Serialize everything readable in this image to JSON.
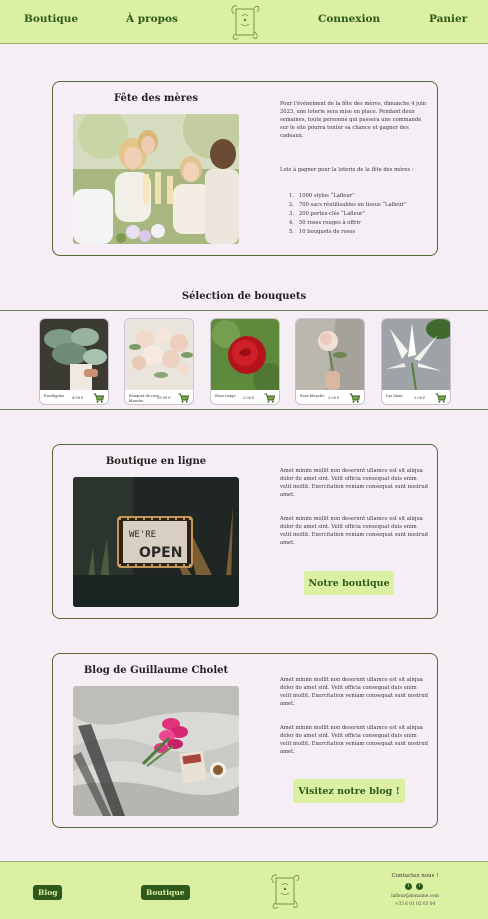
{
  "colors": {
    "accent": "#dbf0a2",
    "brand_green": "#2d5a1b",
    "background": "#f5eff5",
    "card_border": "#4e6b34"
  },
  "header": {
    "nav": [
      "Boutique",
      "À propos",
      "Connexion",
      "Panier"
    ],
    "logo_icon": "flower-card-logo-icon"
  },
  "mothers_day": {
    "title": "Fête des mères",
    "intro": "Pour l'événement de la fête des mères, dimanche 4 juin 2023, une loterie sera mise en place. Pendant deux semaines, toute personne qui passera une commande sur le site pourra tenter sa chance et gagner des cadeaux.",
    "lottery_heading": "Lots à gagner pour la loterie de la fête des mères :",
    "prizes": [
      {
        "num": "1.",
        "text": "1000 stylos “Lafleur”"
      },
      {
        "num": "2.",
        "text": "700 sacs réutilisables en tissus “Lafleur”"
      },
      {
        "num": "3.",
        "text": "200 portes-clés “Lafleur”"
      },
      {
        "num": "4.",
        "text": "50 roses rouges à offrir"
      },
      {
        "num": "5.",
        "text": "10 bouquets de roses"
      }
    ]
  },
  "selection": {
    "title": "Sélection de bouquets",
    "products": [
      {
        "name": "Eucalyptus",
        "price": "4.99 €"
      },
      {
        "name": "Bouquet de rose blanche",
        "price": "29.99 €"
      },
      {
        "name": "Rose rouge",
        "price": "2.00 €"
      },
      {
        "name": "Rose blanche",
        "price": "2.00 €"
      },
      {
        "name": "Lys blanc",
        "price": "2.00 €"
      }
    ]
  },
  "online_shop": {
    "title": "Boutique en ligne",
    "para1": "Amet minim mollit non deserunt ullamco est sit aliqua dolor do amet sint. Velit officia consequat duis enim velit mollit. Exercitation veniam consequat sunt nostrud amet.",
    "para2": "Amet minim mollit non deserunt ullamco est sit aliqua dolor do amet sint. Velit officia consequat duis enim velit mollit. Exercitation veniam consequat sunt nostrud amet.",
    "button": "Notre boutique",
    "sign_text_1": "WE'RE",
    "sign_text_2": "OPEN"
  },
  "blog": {
    "title": "Blog de Guillaume Cholet",
    "para1": "Amet minim mollit non deserunt ullamco est sit aliqua dolor do amet sint. Velit officia consequat duis enim velit mollit. Exercitation veniam consequat sunt nostrud amet.",
    "para2": "Amet minim mollit non deserunt ullamco est sit aliqua dolor do amet sint. Velit officia consequat duis enim velit mollit. Exercitation veniam consequat sunt nostrud amet.",
    "button": "Visitez notre blog !"
  },
  "footer": {
    "blog_button": "Blog",
    "shop_button": "Boutique",
    "contact_title": "Contactez nous !",
    "twitter_icon": "twitter-icon",
    "facebook_icon": "facebook-icon",
    "email": "lafleur@domaine.com",
    "phone": "+33 6 01 02 03 04"
  }
}
